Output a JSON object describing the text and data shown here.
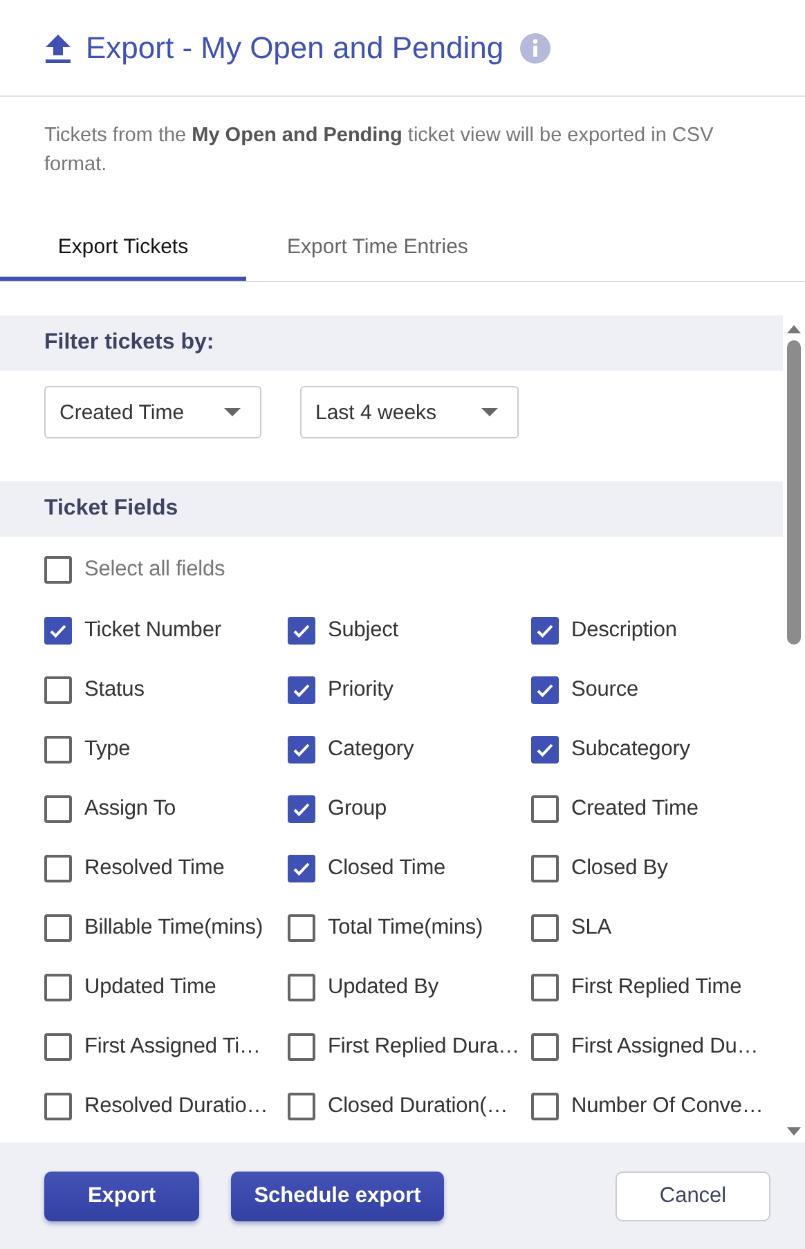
{
  "dialog": {
    "title": "Export - My Open and Pending",
    "description": "Tickets from the **My Open and Pending** ticket view will be exported in CSV format."
  },
  "tabs": [
    {
      "label": "Export Tickets",
      "selected": true
    },
    {
      "label": "Export Time Entries",
      "selected": false
    }
  ],
  "filter": {
    "heading": "Filter tickets by:",
    "dropdowns": [
      {
        "value": "Created Time"
      },
      {
        "value": "Last 4 weeks"
      }
    ]
  },
  "ticket_fields": {
    "heading": "Ticket Fields",
    "select_all": {
      "label": "Select all fields",
      "checked": false
    },
    "fields": [
      {
        "label": "Ticket Number",
        "checked": true
      },
      {
        "label": "Subject",
        "checked": true
      },
      {
        "label": "Description",
        "checked": true
      },
      {
        "label": "Status",
        "checked": false
      },
      {
        "label": "Priority",
        "checked": true
      },
      {
        "label": "Source",
        "checked": true
      },
      {
        "label": "Type",
        "checked": false
      },
      {
        "label": "Category",
        "checked": true
      },
      {
        "label": "Subcategory",
        "checked": true
      },
      {
        "label": "Assign To",
        "checked": false
      },
      {
        "label": "Group",
        "checked": true
      },
      {
        "label": "Created Time",
        "checked": false
      },
      {
        "label": "Resolved Time",
        "checked": false
      },
      {
        "label": "Closed Time",
        "checked": true
      },
      {
        "label": "Closed By",
        "checked": false
      },
      {
        "label": "Billable Time(mins)",
        "checked": false
      },
      {
        "label": "Total Time(mins)",
        "checked": false
      },
      {
        "label": "SLA",
        "checked": false
      },
      {
        "label": "Updated Time",
        "checked": false
      },
      {
        "label": "Updated By",
        "checked": false
      },
      {
        "label": "First Replied Time",
        "checked": false
      },
      {
        "label": "First Assigned Ti…",
        "checked": false
      },
      {
        "label": "First Replied Dura…",
        "checked": false
      },
      {
        "label": "First Assigned Du…",
        "checked": false
      },
      {
        "label": "Resolved Duratio…",
        "checked": false
      },
      {
        "label": "Closed Duration(…",
        "checked": false
      },
      {
        "label": "Number Of Conve…",
        "checked": false
      }
    ]
  },
  "buttons": [
    {
      "label": "Export",
      "kind": "primary"
    },
    {
      "label": "Schedule export",
      "kind": "primary"
    },
    {
      "label": "Cancel",
      "kind": "secondary"
    }
  ]
}
